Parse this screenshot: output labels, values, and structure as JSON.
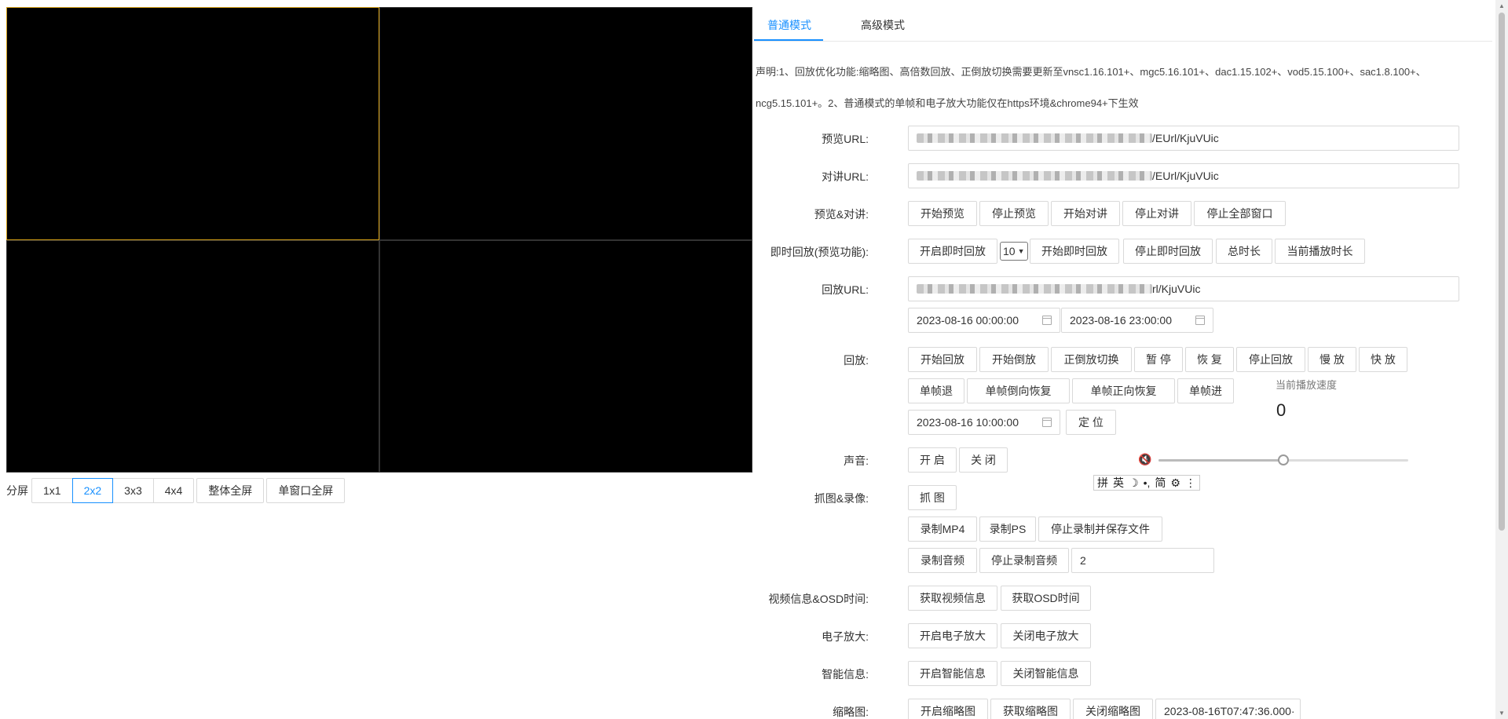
{
  "split": {
    "label": "分屏",
    "options": [
      "1x1",
      "2x2",
      "3x3",
      "4x4"
    ],
    "selected": "2x2",
    "fullscreen_all": "整体全屏",
    "fullscreen_single": "单窗口全屏"
  },
  "tabs": [
    {
      "label": "普通模式",
      "active": true
    },
    {
      "label": "高级模式",
      "active": false
    }
  ],
  "notice": {
    "line1": "声明:1、回放优化功能:缩略图、高倍数回放、正倒放切换需要更新至vnsc1.16.101+、mgc5.16.101+、dac1.15.102+、vod5.15.100+、sac1.8.100+、",
    "line2": "ncg5.15.101+。2、普通模式的单帧和电子放大功能仅在https环境&chrome94+下生效"
  },
  "preview": {
    "label": "预览URL:",
    "url_suffix": "/EUrl/KjuVUic"
  },
  "talk": {
    "label": "对讲URL:",
    "url_suffix": "/EUrl/KjuVUic"
  },
  "preview_talk": {
    "label": "预览&对讲:",
    "buttons": [
      "开始预览",
      "停止预览",
      "开始对讲",
      "停止对讲",
      "停止全部窗口"
    ]
  },
  "instant": {
    "label": "即时回放(预览功能):",
    "open": "开启即时回放",
    "select_value": "10",
    "start": "开始即时回放",
    "stop": "停止即时回放",
    "total": "总时长",
    "current": "当前播放时长"
  },
  "playback_url": {
    "label": "回放URL:",
    "url_suffix": "rl/KjuVUic",
    "start_time": "2023-08-16 00:00:00",
    "end_time": "2023-08-16 23:00:00"
  },
  "playback": {
    "label": "回放:",
    "row1": [
      "开始回放",
      "开始倒放",
      "正倒放切换",
      "暂 停",
      "恢 复",
      "停止回放",
      "慢 放",
      "快 放"
    ],
    "row2": [
      "单帧退",
      "单帧倒向恢复",
      "单帧正向恢复",
      "单帧进"
    ],
    "seek_time": "2023-08-16 10:00:00",
    "seek": "定 位",
    "speed_label": "当前播放速度",
    "speed_value": "0"
  },
  "audio": {
    "label": "声音:",
    "on": "开 启",
    "off": "关 闭",
    "volume": 0.5,
    "mute_icon": "volume-mute-icon"
  },
  "ime": {
    "items": [
      "拼",
      "英",
      "☽",
      "•,",
      "简",
      "⚙",
      "⋮"
    ]
  },
  "capture": {
    "label": "抓图&录像:",
    "snapshot": "抓 图",
    "rec_mp4": "录制MP4",
    "rec_ps": "录制PS",
    "stop_save": "停止录制并保存文件",
    "rec_audio": "录制音频",
    "stop_audio": "停止录制音频",
    "audio_value": "2"
  },
  "videoinfo": {
    "label": "视频信息&OSD时间:",
    "get_info": "获取视频信息",
    "get_osd": "获取OSD时间"
  },
  "ezoom": {
    "label": "电子放大:",
    "on": "开启电子放大",
    "off": "关闭电子放大"
  },
  "smart": {
    "label": "智能信息:",
    "on": "开启智能信息",
    "off": "关闭智能信息"
  },
  "thumb": {
    "label": "缩略图:",
    "on": "开启缩略图",
    "get": "获取缩略图",
    "off": "关闭缩略图",
    "time": "2023-08-16T07:47:36.000·"
  }
}
